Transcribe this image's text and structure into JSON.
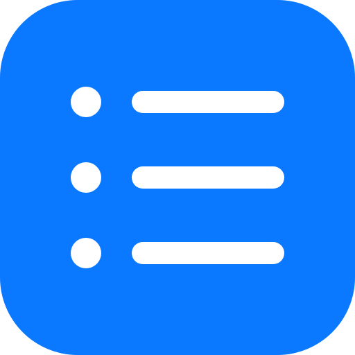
{
  "icon": {
    "name": "list-bullet-icon",
    "background_color": "#0A78FF",
    "foreground_color": "#FFFFFF",
    "rows": [
      {
        "bullet": "bullet-icon",
        "line": "line"
      },
      {
        "bullet": "bullet-icon",
        "line": "line"
      },
      {
        "bullet": "bullet-icon",
        "line": "line"
      }
    ]
  }
}
